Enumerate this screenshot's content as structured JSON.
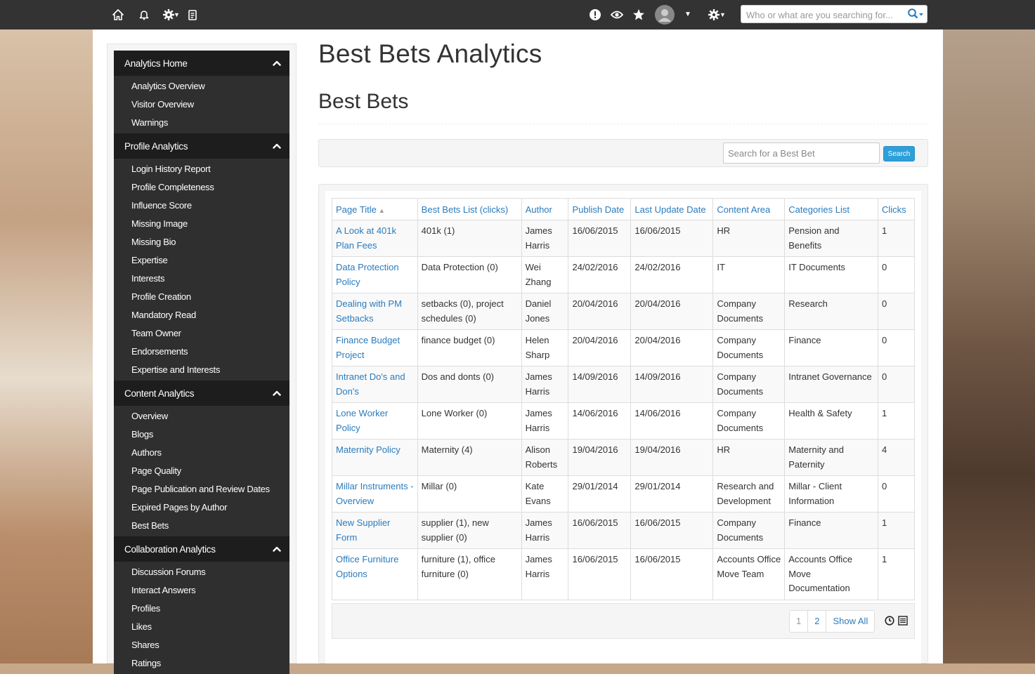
{
  "topbar": {
    "search_placeholder": "Who or what are you searching for..."
  },
  "sidebar": {
    "sections": [
      {
        "title": "Analytics Home",
        "items": [
          "Analytics Overview",
          "Visitor Overview",
          "Warnings"
        ]
      },
      {
        "title": "Profile Analytics",
        "items": [
          "Login History Report",
          "Profile Completeness",
          "Influence Score",
          "Missing Image",
          "Missing Bio",
          "Expertise",
          "Interests",
          "Profile Creation",
          "Mandatory Read",
          "Team Owner",
          "Endorsements",
          "Expertise and Interests"
        ]
      },
      {
        "title": "Content Analytics",
        "items": [
          "Overview",
          "Blogs",
          "Authors",
          "Page Quality",
          "Page Publication and Review Dates",
          "Expired Pages by Author",
          "Best Bets"
        ]
      },
      {
        "title": "Collaboration Analytics",
        "items": [
          "Discussion Forums",
          "Interact Answers",
          "Profiles",
          "Likes",
          "Shares",
          "Ratings"
        ]
      }
    ]
  },
  "page": {
    "title": "Best Bets Analytics",
    "subtitle": "Best Bets",
    "search_placeholder": "Search for a Best Bet",
    "search_button": "Search"
  },
  "table": {
    "headers": [
      "Page Title",
      "Best Bets List (clicks)",
      "Author",
      "Publish Date",
      "Last Update Date",
      "Content Area",
      "Categories List",
      "Clicks"
    ],
    "rows": [
      [
        "A Look at 401k Plan Fees",
        "401k (1)",
        "James Harris",
        "16/06/2015",
        "16/06/2015",
        "HR",
        "Pension and Benefits",
        "1"
      ],
      [
        "Data Protection Policy",
        "Data Protection (0)",
        "Wei Zhang",
        "24/02/2016",
        "24/02/2016",
        "IT",
        "IT Documents",
        "0"
      ],
      [
        "Dealing with PM Setbacks",
        "setbacks (0), project schedules (0)",
        "Daniel Jones",
        "20/04/2016",
        "20/04/2016",
        "Company Documents",
        "Research",
        "0"
      ],
      [
        "Finance Budget Project",
        "finance budget (0)",
        "Helen Sharp",
        "20/04/2016",
        "20/04/2016",
        "Company Documents",
        "Finance",
        "0"
      ],
      [
        "Intranet Do's and Don's",
        "Dos and donts (0)",
        "James Harris",
        "14/09/2016",
        "14/09/2016",
        "Company Documents",
        "Intranet Governance",
        "0"
      ],
      [
        "Lone Worker Policy",
        "Lone Worker (0)",
        "James Harris",
        "14/06/2016",
        "14/06/2016",
        "Company Documents",
        "Health & Safety",
        "1"
      ],
      [
        "Maternity Policy",
        "Maternity (4)",
        "Alison Roberts",
        "19/04/2016",
        "19/04/2016",
        "HR",
        "Maternity and Paternity",
        "4"
      ],
      [
        "Millar Instruments - Overview",
        "Millar (0)",
        "Kate Evans",
        "29/01/2014",
        "29/01/2014",
        "Research and Development",
        "Millar - Client Information",
        "0"
      ],
      [
        "New Supplier Form",
        "supplier (1), new supplier (0)",
        "James Harris",
        "16/06/2015",
        "16/06/2015",
        "Company Documents",
        "Finance",
        "1"
      ],
      [
        "Office Furniture Options",
        "furniture (1), office furniture (0)",
        "James Harris",
        "16/06/2015",
        "16/06/2015",
        "Accounts Office Move Team",
        "Accounts Office Move Documentation",
        "1"
      ]
    ]
  },
  "pager": {
    "pages": [
      "1",
      "2"
    ],
    "show_all": "Show All"
  },
  "colors": {
    "topbar": "#333333",
    "sidebar_header": "#1d1d1d",
    "sidebar_bg": "#2f2f2f",
    "link": "#2a7bbd",
    "search_button": "#2d9fd9"
  }
}
